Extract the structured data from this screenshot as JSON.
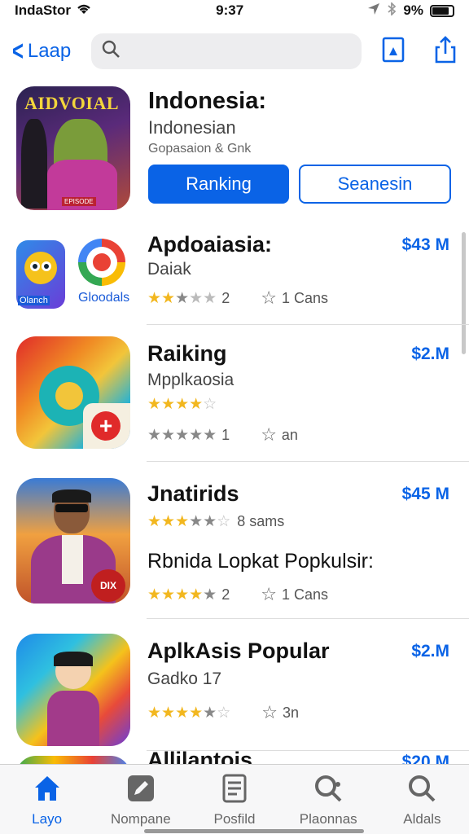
{
  "status_bar": {
    "carrier": "IndaStor",
    "time": "9:37",
    "battery": "9%"
  },
  "nav": {
    "back_label": "Laap",
    "search_placeholder": ""
  },
  "featured": {
    "icon_text": "AIDVOIAL",
    "badge_text": "EPISODE",
    "title": "Indonesia:",
    "subtitle": "Indonesian",
    "meta": "Gopasaion & Gnk",
    "primary_button": "Ranking",
    "secondary_button": "Seanesin"
  },
  "rows": [
    {
      "name": "Apdoaiasia:",
      "price": "$43 M",
      "sub": "Daiak",
      "rating": 3.5,
      "count": "2",
      "fav": "1 Cans",
      "icon_label": "Olanch",
      "icon_label2": "Gloodals"
    },
    {
      "name": "Raiking",
      "price": "$2.M",
      "sub": "Mpplkaosia",
      "rating": 4.5,
      "rating2": 5,
      "count": "1",
      "fav": "an"
    },
    {
      "name": "Jnatirids",
      "price": "$45 M",
      "rating": 3.5,
      "count_text": "8 sams",
      "tagline": "Rbnida Lopkat Popkulsir:",
      "rating2": 4,
      "count": "2",
      "fav": "1 Cans"
    },
    {
      "name": "AplkAsis Popular",
      "price": "$2.M",
      "sub": "Gadko 17",
      "rating": 4.5,
      "fav": "3n"
    },
    {
      "name": "Allilantois",
      "price": "$20 M"
    }
  ],
  "tabs": [
    {
      "label": "Layo",
      "icon": "home-icon",
      "active": true
    },
    {
      "label": "Nompane",
      "icon": "edit-icon",
      "active": false
    },
    {
      "label": "Posfild",
      "icon": "document-icon",
      "active": false
    },
    {
      "label": "Plaonnas",
      "icon": "search-gear-icon",
      "active": false
    },
    {
      "label": "Aldals",
      "icon": "search-icon",
      "active": false
    }
  ],
  "colors": {
    "accent": "#0a63e6",
    "star": "#f2b71f"
  }
}
